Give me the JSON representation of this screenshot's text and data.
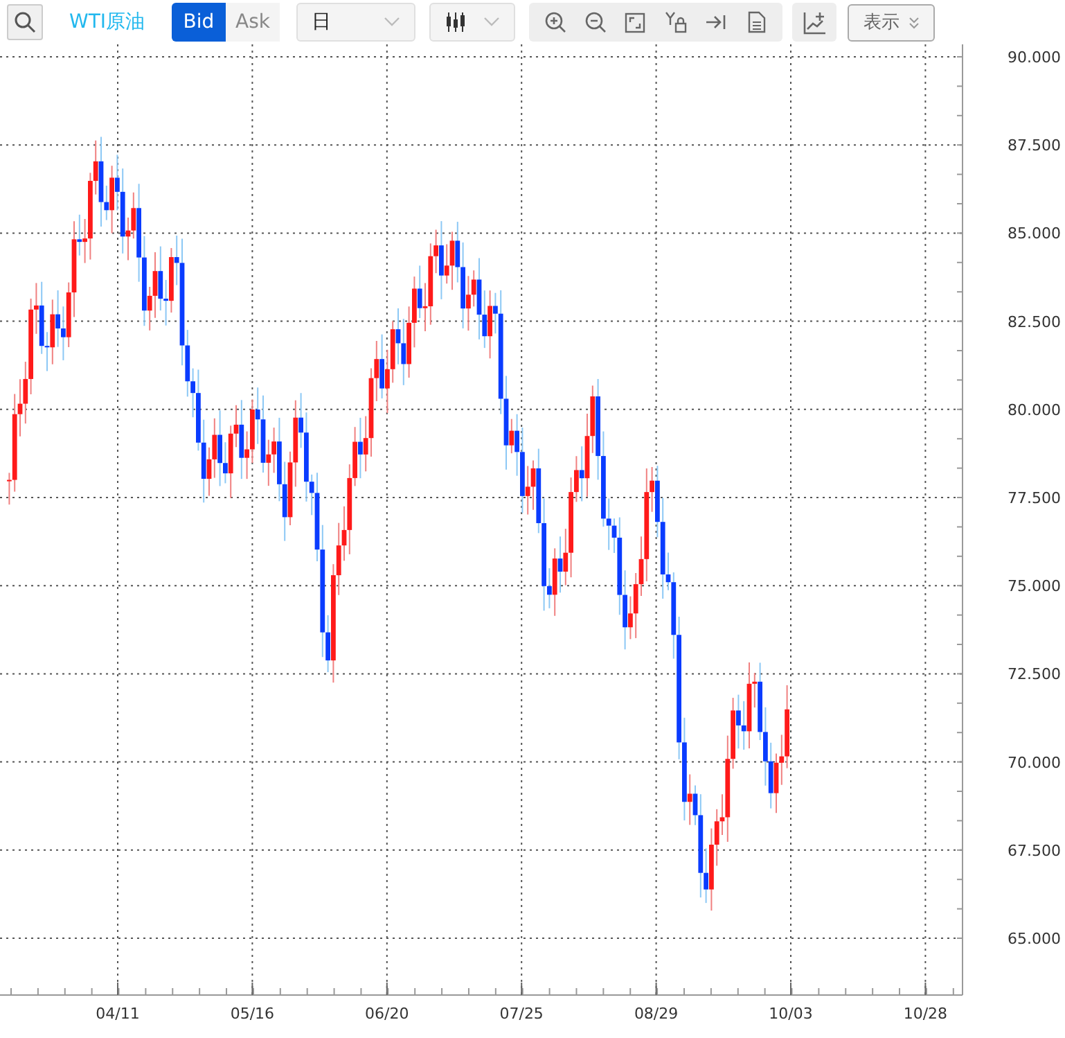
{
  "toolbar": {
    "symbol": "WTI原油",
    "price_sides": [
      {
        "label": "Bid",
        "selected": true
      },
      {
        "label": "Ask",
        "selected": false
      }
    ],
    "period": {
      "value": "日"
    },
    "display_button": {
      "label": "表示"
    }
  },
  "chart": {
    "y_labels": [
      "90.000",
      "87.500",
      "85.000",
      "82.500",
      "80.000",
      "77.500",
      "75.000",
      "72.500",
      "70.000",
      "67.500",
      "65.000"
    ],
    "x_labels": [
      "04/11",
      "05/16",
      "06/20",
      "07/25",
      "08/29",
      "10/03",
      "10/28"
    ]
  }
}
